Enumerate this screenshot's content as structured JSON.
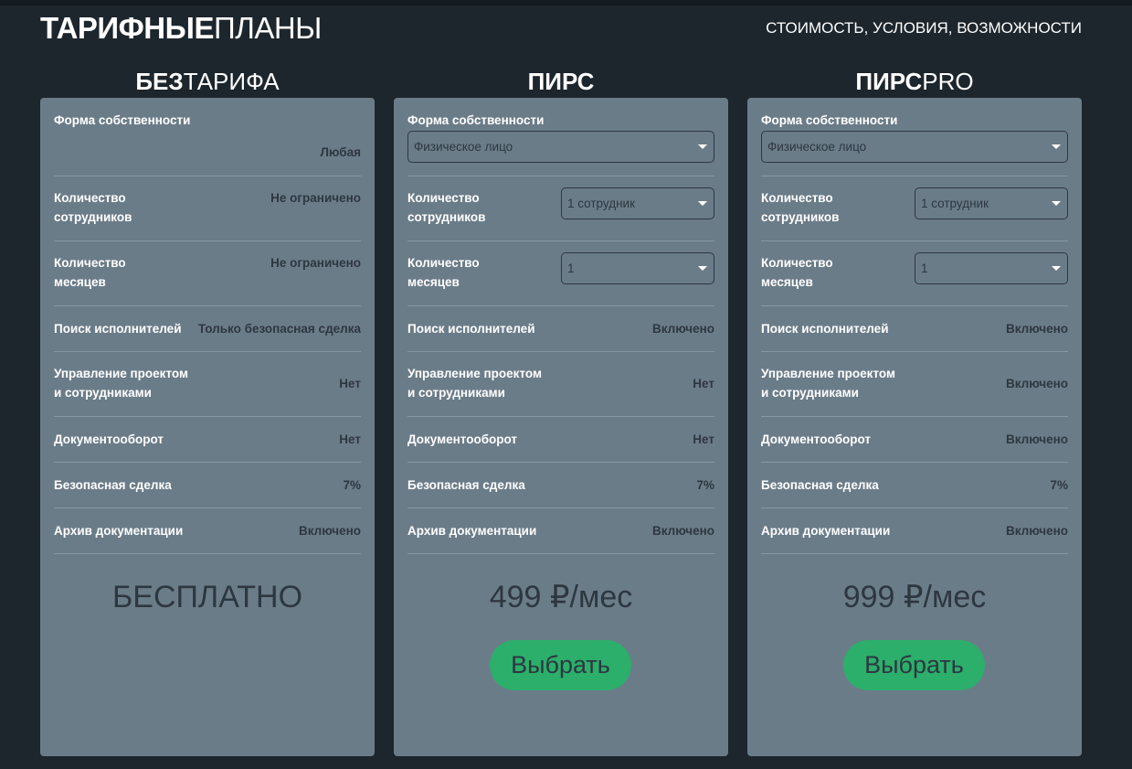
{
  "header": {
    "title_bold": "ТАРИФНЫЕ",
    "title_light": "ПЛАНЫ",
    "subtitle": "СТОИМОСТЬ, УСЛОВИЯ, ВОЗМОЖНОСТИ"
  },
  "plans": [
    {
      "name_bold": "БЕЗ",
      "name_light": "ТАРИФА",
      "rows": {
        "ownership_label": "Форма собственности",
        "ownership_value": "Любая",
        "employees_label_1": "Количество",
        "employees_label_2": "сотрудников",
        "employees_value": "Не ограничено",
        "months_label_1": "Количество",
        "months_label_2": "месяцев",
        "months_value": "Не ограничено",
        "search_label": "Поиск исполнителей",
        "search_value": "Только безопасная сделка",
        "mgmt_label_1": "Управление проектом",
        "mgmt_label_2": "и сотрудниками",
        "mgmt_value": "Нет",
        "docflow_label": "Документооборот",
        "docflow_value": "Нет",
        "deal_label": "Безопасная сделка",
        "deal_value": "7%",
        "archive_label": "Архив документации",
        "archive_value": "Включено"
      },
      "price": "БЕСПЛАТНО"
    },
    {
      "name_bold": "ПИРС",
      "name_light": "",
      "rows": {
        "ownership_label": "Форма собственности",
        "ownership_select": "Физическое лицо",
        "employees_label_1": "Количество",
        "employees_label_2": "сотрудников",
        "employees_select": "1 сотрудник",
        "months_label_1": "Количество",
        "months_label_2": "месяцев",
        "months_select": "1",
        "search_label": "Поиск исполнителей",
        "search_value": "Включено",
        "mgmt_label_1": "Управление проектом",
        "mgmt_label_2": "и сотрудниками",
        "mgmt_value": "Нет",
        "docflow_label": "Документооборот",
        "docflow_value": "Нет",
        "deal_label": "Безопасная сделка",
        "deal_value": "7%",
        "archive_label": "Архив документации",
        "archive_value": "Включено"
      },
      "price": "499 ₽/мес",
      "button": "Выбрать"
    },
    {
      "name_bold": "ПИРС",
      "name_light": "PRO",
      "rows": {
        "ownership_label": "Форма собственности",
        "ownership_select": "Физическое лицо",
        "employees_label_1": "Количество",
        "employees_label_2": "сотрудников",
        "employees_select": "1 сотрудник",
        "months_label_1": "Количество",
        "months_label_2": "месяцев",
        "months_select": "1",
        "search_label": "Поиск исполнителей",
        "search_value": "Включено",
        "mgmt_label_1": "Управление проектом",
        "mgmt_label_2": "и сотрудниками",
        "mgmt_value": "Включено",
        "docflow_label": "Документооборот",
        "docflow_value": "Включено",
        "deal_label": "Безопасная сделка",
        "deal_value": "7%",
        "archive_label": "Архив документации",
        "archive_value": "Включено"
      },
      "price": "999 ₽/мес",
      "button": "Выбрать"
    }
  ],
  "colors": {
    "background": "#1d262d",
    "card": "#6b7c89",
    "button": "#2baf6b",
    "dark_text": "#2d3740"
  }
}
